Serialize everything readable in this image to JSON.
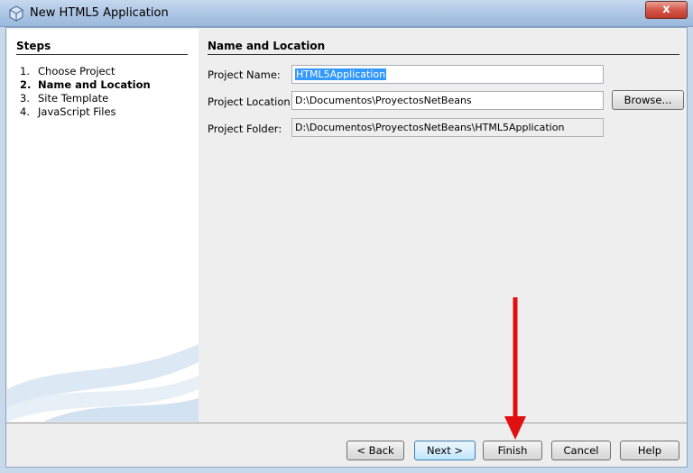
{
  "window": {
    "title": "New HTML5 Application",
    "close_label": "x"
  },
  "steps": {
    "heading": "Steps",
    "items": [
      {
        "num": "1.",
        "label": "Choose Project",
        "active": false
      },
      {
        "num": "2.",
        "label": "Name and Location",
        "active": true
      },
      {
        "num": "3.",
        "label": "Site Template",
        "active": false
      },
      {
        "num": "4.",
        "label": "JavaScript Files",
        "active": false
      }
    ]
  },
  "panel": {
    "heading": "Name and Location",
    "project_name_label": "Project Name:",
    "project_name_value": "HTML5Application",
    "project_location_label": "Project Location:",
    "project_location_value": "D:\\Documentos\\ProyectosNetBeans",
    "browse_label": "Browse...",
    "project_folder_label": "Project Folder:",
    "project_folder_value": "D:\\Documentos\\ProyectosNetBeans\\HTML5Application"
  },
  "footer": {
    "back_label": "< Back",
    "next_label": "Next >",
    "finish_label": "Finish",
    "cancel_label": "Cancel",
    "help_label": "Help"
  },
  "colors": {
    "selection": "#3399ff",
    "arrow": "#e01010",
    "titlebar": "#a9c3e2"
  }
}
